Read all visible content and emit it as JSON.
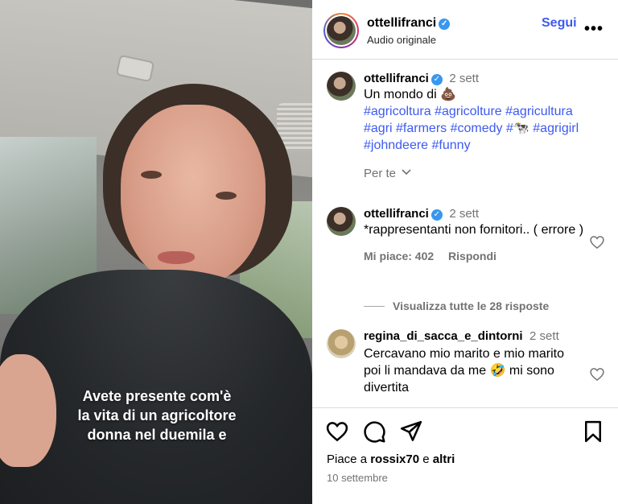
{
  "video": {
    "caption_lines": [
      "Avete presente com'è",
      "la vita di un agricoltore",
      "donna nel duemila e"
    ]
  },
  "header": {
    "username": "ottellifranci",
    "subtitle": "Audio originale",
    "follow_label": "Segui",
    "more_label": "•••"
  },
  "post": {
    "username": "ottellifranci",
    "time": "2 sett",
    "text": "Un mondo di 💩",
    "hashtags": [
      "#agricoltura",
      "#agricolture",
      "#agricultura",
      "#agri",
      "#farmers",
      "#comedy",
      "#🐄",
      "#agrigirl",
      "#johndeere",
      "#funny"
    ],
    "per_te_label": "Per te"
  },
  "comments": [
    {
      "username": "ottellifranci",
      "time": "2 sett",
      "text": "*rappresentanti non fornitori.. ( errore )",
      "likes_label": "Mi piace: 402",
      "reply_label": "Rispondi",
      "view_replies": "Visualizza tutte le 28 risposte"
    },
    {
      "username": "regina_di_sacca_e_dintorni",
      "time": "2 sett",
      "text": "Cercavano mio marito e mio marito poi li mandava da me 🤣 mi sono divertita"
    }
  ],
  "footer": {
    "likes_prefix": "Piace a ",
    "likes_user": "rossix70",
    "likes_middle": " e ",
    "likes_suffix": "altri",
    "date": "10 settembre"
  },
  "colors": {
    "link_blue": "#3d5af1",
    "verified_blue": "#3897f0",
    "muted": "#737373",
    "border": "#dbdbdb"
  },
  "icons": [
    "heart-icon",
    "comment-icon",
    "share-icon",
    "bookmark-icon",
    "verified-icon",
    "chevron-down-icon",
    "more-icon"
  ]
}
